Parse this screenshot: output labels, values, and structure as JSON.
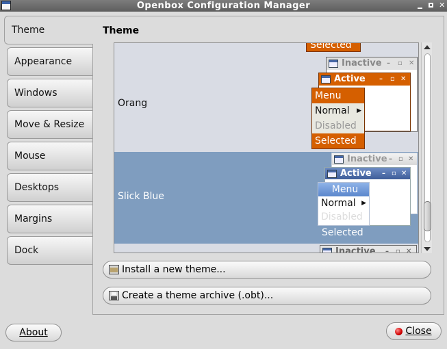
{
  "window": {
    "title": "Openbox Configuration Manager",
    "controls": [
      "minimize-icon",
      "maximize-icon",
      "close-icon"
    ]
  },
  "sidebar": {
    "items": [
      {
        "label": "Theme",
        "active": true
      },
      {
        "label": "Appearance"
      },
      {
        "label": "Windows"
      },
      {
        "label": "Move & Resize"
      },
      {
        "label": "Mouse"
      },
      {
        "label": "Desktops"
      },
      {
        "label": "Margins"
      },
      {
        "label": "Dock"
      }
    ]
  },
  "main": {
    "title": "Theme",
    "themes": [
      {
        "name": "Orang",
        "preview": {
          "partial_top": "Selected",
          "inactive": "Inactive",
          "active": "Active",
          "menu": {
            "title": "Menu",
            "items": [
              "Normal",
              "Disabled",
              "Selected"
            ]
          }
        }
      },
      {
        "name": "Slick Blue",
        "selected": true,
        "preview": {
          "inactive": "Inactive",
          "active": "Active",
          "menu": {
            "title": "Menu",
            "items": [
              "Normal",
              "Disabled",
              "Selected"
            ]
          }
        }
      },
      {
        "name": "",
        "preview": {
          "inactive": "Inactive"
        }
      }
    ],
    "install_button": "Install a new theme...",
    "archive_button": "Create a theme archive (.obt)..."
  },
  "footer": {
    "about": "About",
    "close": "Close"
  },
  "colors": {
    "orange_accent": "#d55f00",
    "slick_selected_row": "#7f9dbf",
    "slick_active_title": "#4d6da9"
  }
}
